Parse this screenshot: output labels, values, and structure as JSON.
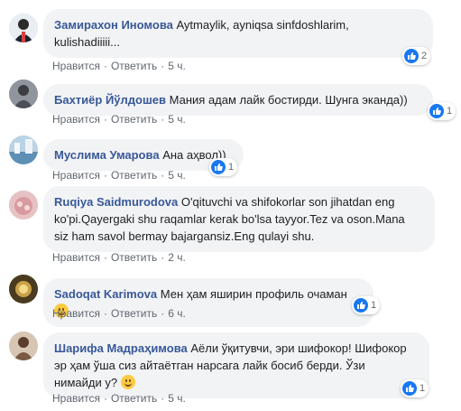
{
  "actions": {
    "like_label": "Нравится",
    "reply_label": "Ответить",
    "separator": "·"
  },
  "colors": {
    "author": "#385898",
    "bubble": "#f2f3f5",
    "like": "#1877f2",
    "meta": "#606770"
  },
  "comments": [
    {
      "author": "Замирахон Иномова",
      "lines": [
        "Aytmaylik, ayniqsa sinfdoshlarim,",
        "kulishadiiiii..."
      ],
      "time": "5 ч.",
      "reactions": "2",
      "reaction_icon": "like-icon"
    },
    {
      "author": "Бахтиёр Йўлдошев",
      "lines": [
        "Мания адам лайк бостирди. Шунга эканда))"
      ],
      "time": "5 ч.",
      "reactions": "1",
      "reaction_icon": "like-icon"
    },
    {
      "author": "Муслима Умарова",
      "lines": [
        "Ана аҳвол))"
      ],
      "time": "5 ч.",
      "reactions": "1",
      "reaction_icon": "like-icon"
    },
    {
      "author": "Ruqiya Saidmurodova",
      "lines": [
        "O'qituvchi va shifokorlar son jihatdan eng",
        "ko'pi.Qayergaki shu raqamlar kerak bo'lsa tayyor.Tez va oson.Mana",
        "siz ham savol bermay bajargansiz.Eng qulayi shu."
      ],
      "time": "2 ч."
    },
    {
      "author": "Sadoqat Karimova",
      "lines": [
        "Мен ҳам яширин профиль очаман"
      ],
      "time": "6 ч.",
      "reactions": "1",
      "reaction_icon": "like-icon",
      "emoji": "grinning-emoji"
    },
    {
      "author": "Шарифа Мадраҳимова",
      "lines": [
        "Аёли ўқитувчи, эри шифокор! Шифокор",
        "эр ҳам ўша сиз айтаётган нарсага лайк босиб берди. Ўзи",
        "нимайди у?"
      ],
      "time": "5 ч.",
      "reactions": "1",
      "reaction_icon": "like-icon",
      "emoji": "grinning-emoji"
    }
  ]
}
